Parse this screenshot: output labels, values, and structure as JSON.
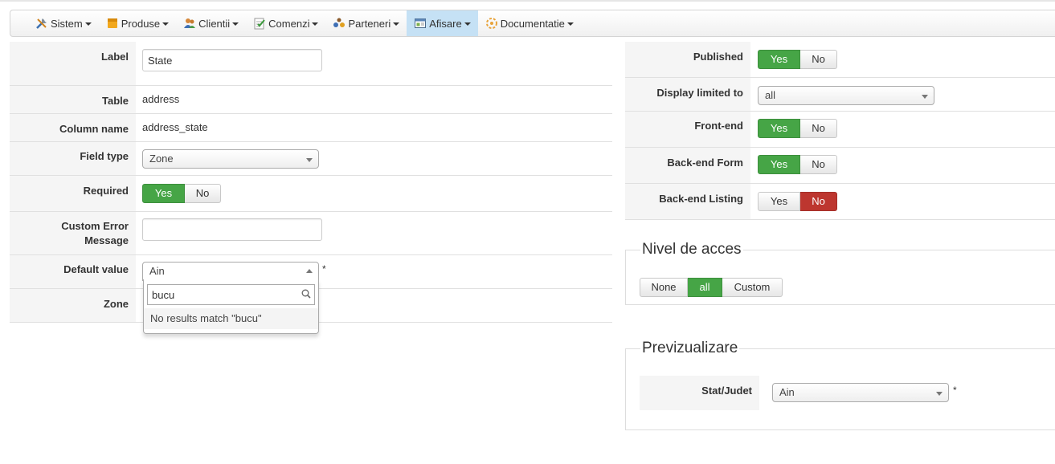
{
  "menu": {
    "items": [
      {
        "label": "Sistem",
        "icon": "tools-icon"
      },
      {
        "label": "Produse",
        "icon": "box-icon"
      },
      {
        "label": "Clientii",
        "icon": "users-icon"
      },
      {
        "label": "Comenzi",
        "icon": "orders-icon"
      },
      {
        "label": "Parteneri",
        "icon": "partners-icon"
      },
      {
        "label": "Afisare",
        "icon": "display-icon",
        "active": true
      },
      {
        "label": "Documentatie",
        "icon": "help-icon"
      }
    ]
  },
  "form": {
    "label": {
      "label": "Label",
      "value": "State"
    },
    "table": {
      "label": "Table",
      "value": "address"
    },
    "column_name": {
      "label": "Column name",
      "value": "address_state"
    },
    "field_type": {
      "label": "Field type",
      "value": "Zone"
    },
    "required": {
      "label": "Required",
      "yes": "Yes",
      "no": "No",
      "selected": "Yes"
    },
    "custom_error": {
      "label_line1": "Custom Error",
      "label_line2": "Message",
      "value": ""
    },
    "default_value": {
      "label": "Default value",
      "value": "Ain",
      "required_mark": "*"
    },
    "zone": {
      "label": "Zone"
    },
    "dropdown": {
      "search_value": "bucu",
      "no_results": "No results match \"bucu\""
    }
  },
  "right": {
    "published": {
      "label": "Published",
      "yes": "Yes",
      "no": "No",
      "selected": "Yes"
    },
    "display_limited": {
      "label": "Display limited to",
      "value": "all"
    },
    "frontend": {
      "label": "Front-end",
      "yes": "Yes",
      "no": "No",
      "selected": "Yes"
    },
    "backend_form": {
      "label": "Back-end Form",
      "yes": "Yes",
      "no": "No",
      "selected": "Yes"
    },
    "backend_listing": {
      "label": "Back-end Listing",
      "yes": "Yes",
      "no": "No",
      "selected": "No"
    }
  },
  "access": {
    "legend": "Nivel de acces",
    "options": [
      "None",
      "all",
      "Custom"
    ],
    "selected": "all"
  },
  "preview": {
    "legend": "Previzualizare",
    "label": "Stat/Judet",
    "value": "Ain",
    "required_mark": "*"
  },
  "colors": {
    "yes_active": "#46a546",
    "no_active": "#bd362f",
    "menu_active": "#c5e1f5",
    "label_bg": "#f5f5f5"
  }
}
